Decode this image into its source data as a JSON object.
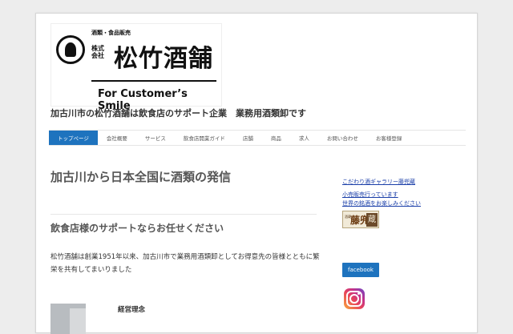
{
  "logo": {
    "category": "酒類・食品販売",
    "company_type": "株式会社",
    "name": "松竹酒舗",
    "slogan": "For Customer’s Smile"
  },
  "tagline": "加古川市の松竹酒舗は飲食店のサポート企業　業務用酒類卸です",
  "nav": {
    "items": [
      "トップページ",
      "会社概要",
      "サービス",
      "飲食店開業ガイド",
      "店舗",
      "商品",
      "求人",
      "お問い合わせ",
      "お客様登録"
    ],
    "active_index": 0
  },
  "main": {
    "title": "加古川から日本全国に酒類の発信",
    "subtitle": "飲食店様のサポートならお任せください",
    "body": "松竹酒舗は創業1951年以来、加古川市で業務用酒類卸としてお得意先の皆様とともに繁栄を共有してまいりました",
    "philosophy_heading": "経営理念"
  },
  "sidebar": {
    "link1": "こだわり酒ギャラリー藤兜蔵",
    "link2": "小売販売行っています",
    "link3": "世界の銘酒をお楽しみください",
    "sake_logo": {
      "small": "酒蔵",
      "main": "藤兜",
      "box": "蔵"
    },
    "facebook_label": "facebook"
  },
  "colors": {
    "accent": "#1e73be",
    "link": "#1a3ea8"
  }
}
